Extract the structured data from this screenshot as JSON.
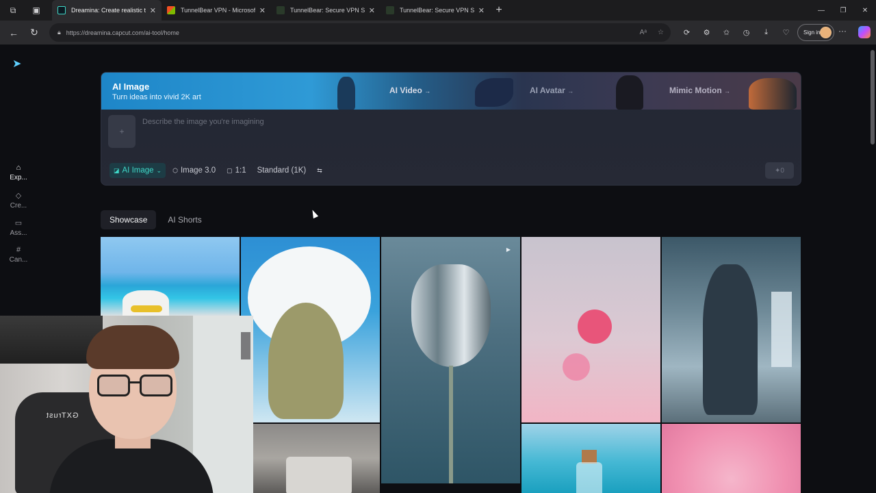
{
  "browser": {
    "tabs": [
      {
        "title": "Dreamina: Create realistic t",
        "active": true,
        "favicon_color": "#0b1a22"
      },
      {
        "title": "TunnelBear VPN - Microsoft",
        "active": false,
        "favicon_color": "#7ab648"
      },
      {
        "title": "TunnelBear: Secure VPN Se",
        "active": false,
        "favicon_color": "#2a3a2a"
      },
      {
        "title": "TunnelBear: Secure VPN Se",
        "active": false,
        "favicon_color": "#2a3a2a"
      }
    ],
    "url": "https://dreamina.capcut.com/ai-tool/home",
    "sign_in": "Sign in"
  },
  "sidebar": {
    "items": [
      {
        "label": "Exp...",
        "icon": "home-icon",
        "active": true
      },
      {
        "label": "Cre...",
        "icon": "diamond-icon",
        "active": false
      },
      {
        "label": "Ass...",
        "icon": "folder-icon",
        "active": false
      },
      {
        "label": "Can...",
        "icon": "canvas-icon",
        "active": false
      }
    ]
  },
  "hero": {
    "title": "AI Image",
    "subtitle": "Turn ideas into vivid 2K art",
    "links": [
      "AI Video",
      "AI Avatar",
      "Mimic Motion"
    ],
    "prompt_placeholder": "Describe the image you're imagining",
    "options": {
      "mode": "AI Image",
      "model": "Image 3.0",
      "ratio": "1:1",
      "quality": "Standard (1K)"
    },
    "generate_credits": "0"
  },
  "content_tabs": [
    "Showcase",
    "AI Shorts"
  ],
  "colors": {
    "accent": "#3fd8c8",
    "hero_strip": "#1e86c8",
    "page_bg": "#0d0e12"
  },
  "webcam_overlay": {
    "chair_brand": "GXTrust"
  }
}
